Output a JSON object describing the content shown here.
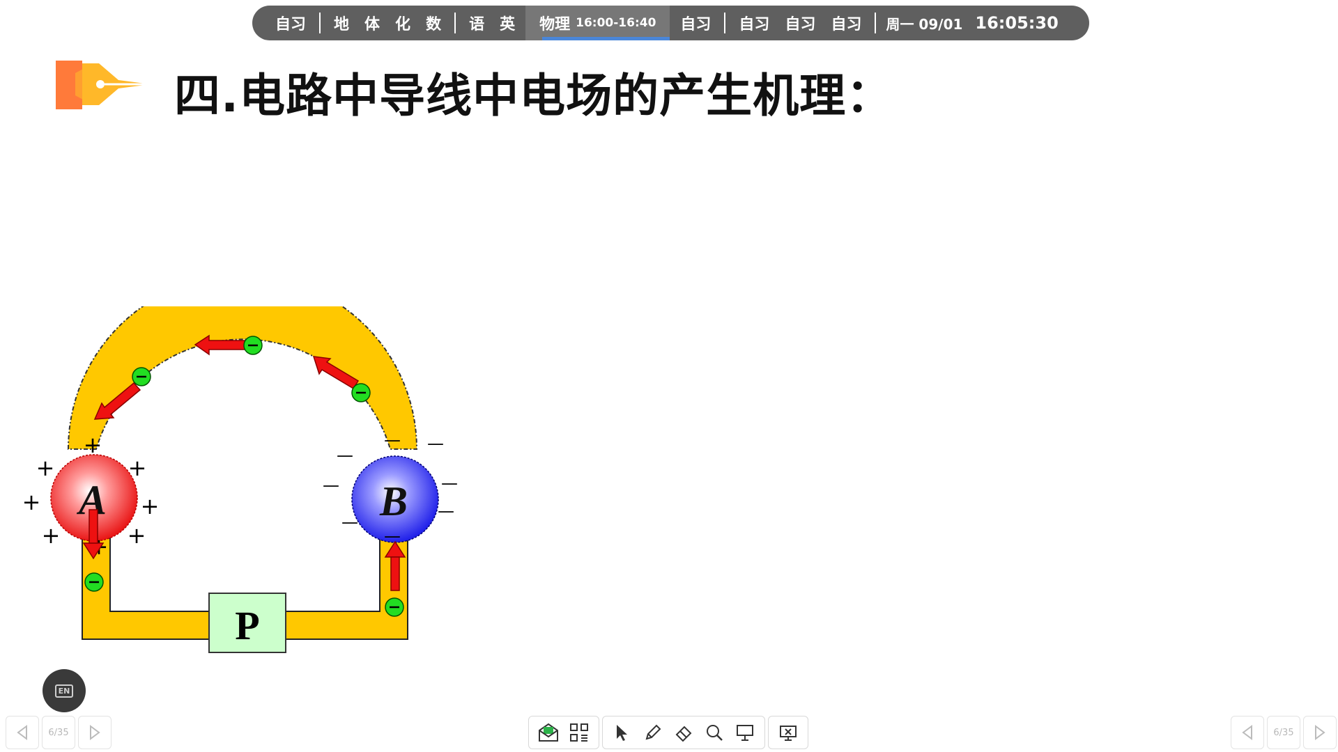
{
  "schedule": {
    "items_left": [
      "自习"
    ],
    "group1": [
      "地",
      "体",
      "化",
      "数"
    ],
    "group2": [
      "语",
      "英"
    ],
    "current": {
      "subject": "物理",
      "time": "16:00-16:40"
    },
    "after_current": [
      "自习"
    ],
    "group3": [
      "自习",
      "自习",
      "自习"
    ],
    "date": "周一 09/01",
    "clock": "16:05:30"
  },
  "slide": {
    "title": "四.电路中导线中电场的产生机理："
  },
  "diagram": {
    "label_a": "A",
    "label_b": "B",
    "label_p": "P",
    "plus": "+",
    "minus": "—",
    "electron": "−",
    "colors": {
      "wire": "#FFC800",
      "sphere_a": "#ee2020",
      "sphere_b": "#2020ee",
      "arrow": "#ee1111",
      "electron": "#22dd22",
      "box_p": "#ccffcc"
    }
  },
  "lang_badge": "EN",
  "pager": {
    "left": "6/35",
    "right": "6/35"
  },
  "toolbar": {
    "icons": [
      "mail-icon",
      "grid-icon",
      "cursor-icon",
      "pen-icon",
      "eraser-icon",
      "search-icon",
      "presenter-icon",
      "close-board-icon"
    ]
  }
}
